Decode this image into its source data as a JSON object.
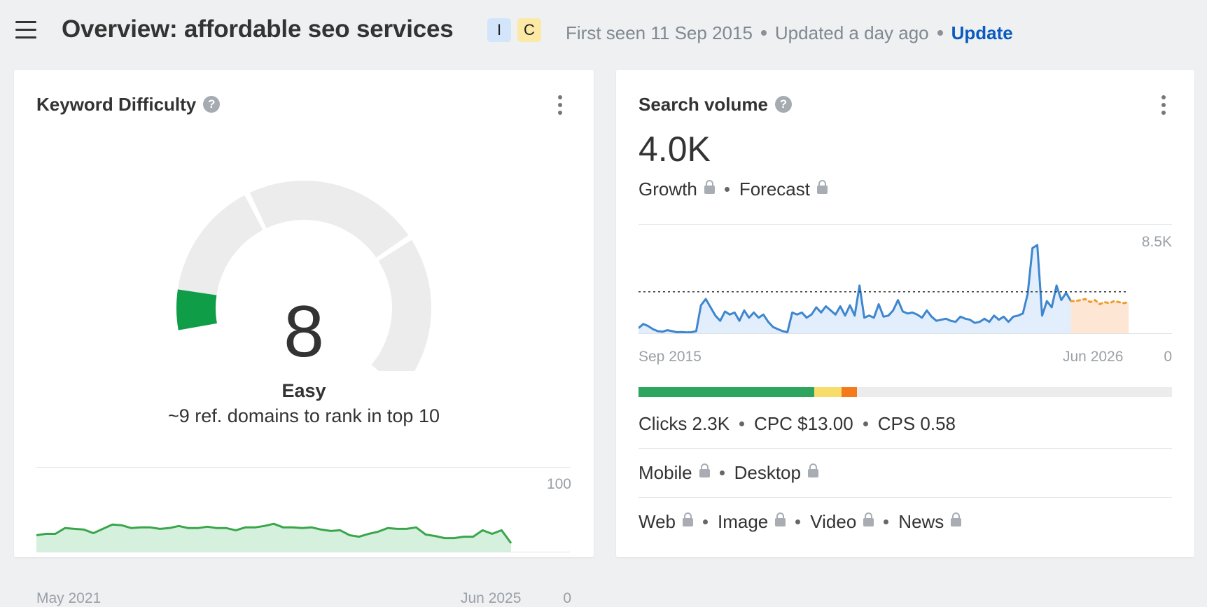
{
  "header": {
    "title": "Overview: affordable seo services",
    "badges": [
      "I",
      "C"
    ],
    "first_seen": "First seen 11 Sep 2015",
    "updated": "Updated a day ago",
    "update_label": "Update"
  },
  "kd_card": {
    "title": "Keyword Difficulty",
    "help": "?",
    "score": "8",
    "score_fraction": 0.08,
    "label": "Easy",
    "subtitle": "~9 ref. domains to rank in top 10",
    "colors": {
      "active": "#0f9d48",
      "inactive": "#ececec",
      "line": "#3aa64c",
      "fill": "#d6f0de"
    },
    "chart_data": {
      "type": "area",
      "x_start": "May 2021",
      "x_end": "Jun 2025",
      "ylim": [
        0,
        100
      ],
      "y_max_label": "100",
      "y_min_label": "0",
      "values": [
        23,
        25,
        25,
        33,
        32,
        31,
        26,
        32,
        38,
        37,
        33,
        34,
        34,
        32,
        33,
        36,
        33,
        33,
        35,
        33,
        33,
        30,
        34,
        34,
        36,
        39,
        34,
        34,
        33,
        34,
        31,
        29,
        30,
        23,
        21,
        25,
        28,
        33,
        32,
        32,
        34,
        24,
        22,
        19,
        19,
        21,
        21,
        30,
        25,
        30,
        12
      ]
    }
  },
  "sv_card": {
    "title": "Search volume",
    "help": "?",
    "value": "4.0K",
    "growth_label": "Growth",
    "forecast_label": "Forecast",
    "colors": {
      "line": "#3e86cf",
      "fill": "#e2eefb",
      "forecast_line": "#f39a2e",
      "forecast_fill": "#fde6d3",
      "avg_line": "#333333"
    },
    "chart_data": {
      "type": "line",
      "x_start": "Sep 2015",
      "x_end": "Jun 2026",
      "ylim": [
        0,
        8500
      ],
      "y_max_label": "8.5K",
      "y_min_label": "0",
      "average": 4000,
      "values": [
        500,
        900,
        700,
        400,
        200,
        150,
        300,
        200,
        100,
        120,
        80,
        100,
        200,
        2700,
        3300,
        2500,
        1700,
        1200,
        2100,
        1800,
        2000,
        1200,
        2200,
        1500,
        2000,
        1500,
        1800,
        1100,
        600,
        400,
        200,
        100,
        2000,
        1800,
        2000,
        1500,
        1800,
        2500,
        2000,
        2600,
        2200,
        1800,
        2600,
        1700,
        2700,
        1700,
        4600,
        1500,
        1700,
        1500,
        2800,
        1600,
        1700,
        2200,
        3200,
        2100,
        1900,
        2000,
        1800,
        1500,
        2200,
        1600,
        1200,
        1300,
        1400,
        1200,
        1100,
        1600,
        1400,
        1300,
        1000,
        1100,
        1400,
        1100,
        1700,
        1300,
        1600,
        1100,
        1600,
        1700,
        1900,
        3800,
        8200,
        8500,
        1700,
        3100,
        2500,
        4600,
        3200,
        3900,
        3100
      ],
      "forecast": [
        3100,
        3200,
        3300,
        3000,
        3200,
        2800,
        3000,
        2900,
        3100,
        3000,
        2900,
        3000
      ]
    },
    "traffic_bar": {
      "segments": [
        {
          "fraction": 0.33,
          "color": "#2da55e"
        },
        {
          "fraction": 0.05,
          "color": "#f8dd6c"
        },
        {
          "fraction": 0.03,
          "color": "#f57a1c"
        }
      ]
    },
    "clicks": "Clicks 2.3K",
    "cpc": "CPC $13.00",
    "cps": "CPS 0.58",
    "device": {
      "mobile": "Mobile",
      "desktop": "Desktop"
    },
    "serp_types": {
      "web": "Web",
      "image": "Image",
      "video": "Video",
      "news": "News"
    }
  }
}
